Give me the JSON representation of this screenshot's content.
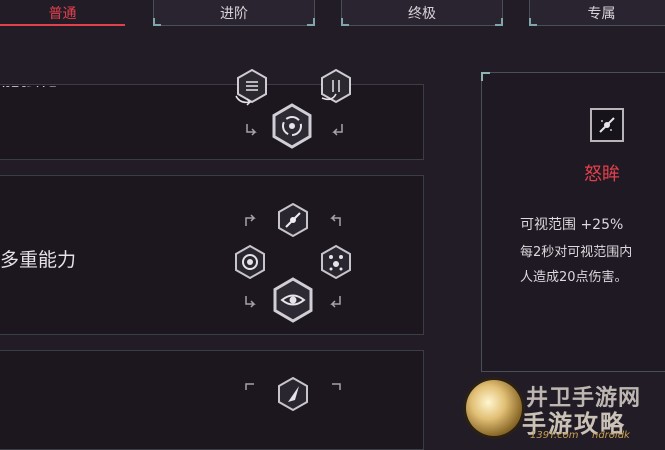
{
  "tabs": [
    {
      "label": "普通",
      "active": true
    },
    {
      "label": "进阶",
      "active": false
    },
    {
      "label": "终极",
      "active": false
    },
    {
      "label": "专属",
      "active": false
    }
  ],
  "skill_rows": [
    {
      "label": "技能强化",
      "icon_groups": [
        "upgrade-cycle"
      ]
    },
    {
      "label": "多重能力",
      "icon_groups": [
        "eye",
        "dots",
        "slash",
        "spiral"
      ]
    },
    {
      "label": "",
      "icon_groups": [
        "feather"
      ]
    }
  ],
  "detail": {
    "icon": "angry-eye-icon",
    "title": "怒眸",
    "stat1": "可视范围 +25%",
    "stat2": "每2秒对可视范围内",
    "stat3": "人造成20点伤害。"
  },
  "watermark": {
    "line1": "井卫手游网",
    "line2": "手游攻略",
    "url1": "139Y.com",
    "url2": "ndroidk"
  },
  "colors": {
    "background": "#221c27",
    "accent_red": "#e0404c",
    "border": "#4a4e58",
    "teal_corner": "#7fa6a8"
  }
}
